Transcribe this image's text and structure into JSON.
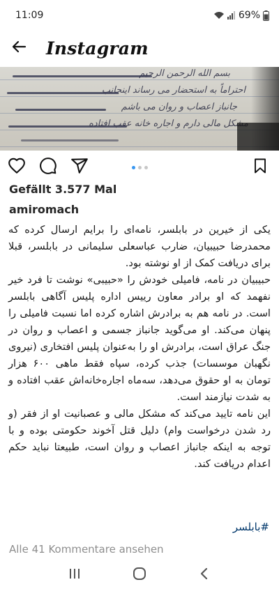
{
  "status_bar": {
    "time": "11:09",
    "battery": "69%",
    "icons": [
      "wifi-icon",
      "signal-icon",
      "battery-icon"
    ]
  },
  "header": {
    "back_icon": "arrow-left-icon",
    "title": "Instagram"
  },
  "post": {
    "image": {
      "description_icon": "handwritten-letter-photo",
      "visible_text": [
        "بسم الله الرحمن الرحیم",
        "احتراماً به استحضار می رساند اینجانب",
        "جانباز اعصاب و روان می باشم",
        "مشکل مالی دارم و اجاره خانه عقب افتاده"
      ]
    },
    "carousel": {
      "count": 3,
      "active_index": 0
    },
    "actions": {
      "like_icon": "heart-icon",
      "comment_icon": "comment-icon",
      "share_icon": "send-icon",
      "save_icon": "bookmark-icon"
    },
    "likes_text": "Gefällt 3.577 Mal",
    "username": "amiromach",
    "caption_paragraphs": [
      "یکی از خیرین در بابلسر، نامه‌ای را برایم ارسال کرده که محمدرضا حبیبیان، ضارب عباسعلی سلیمانی در بابلسر، قبلا برای دریافت کمک از او نوشته بود.",
      "حبیبیان در نامه، فامیلی خودش را «حبیبی» نوشت تا فرد خیر نفهمد که او برادر معاون رییس اداره پلیس آگاهی بابلسر است. در نامه هم به برادرش اشاره کرده اما نسبت فامیلی را پنهان می‌کند. او می‌گوید جانباز جسمی و اعصاب و روان در جنگ عراق است، برادرش او را به‌عنوان پلیس افتخاری (نیروی نگهبان موسسات) جذب کرده، سپاه فقط ماهی ۶۰۰ هزار تومان به او حقوق می‌دهد، سه‌ماه اجاره‌خانه‌اش عقب افتاده و به شدت نیازمند است.",
      "این نامه تایید می‌کند که مشکل مالی و عصبانیت او از فقر (و رد شدن درخواست وام) دلیل قتل آخوند حکومتی بوده و با توجه به اینکه جانباز اعصاب و روان است، طبیعتا نباید حکم اعدام دریافت کند."
    ],
    "hashtag": "#بابلسر",
    "comments_link": "Alle 41 Kommentare ansehen"
  },
  "nav_bar": {
    "recents_icon": "recents-icon",
    "home_icon": "home-circle-icon",
    "back_icon": "chevron-left-icon"
  },
  "colors": {
    "text": "#262626",
    "muted": "#8e8e8e",
    "hashtag": "#00376b",
    "carousel_active": "#3897f0"
  }
}
